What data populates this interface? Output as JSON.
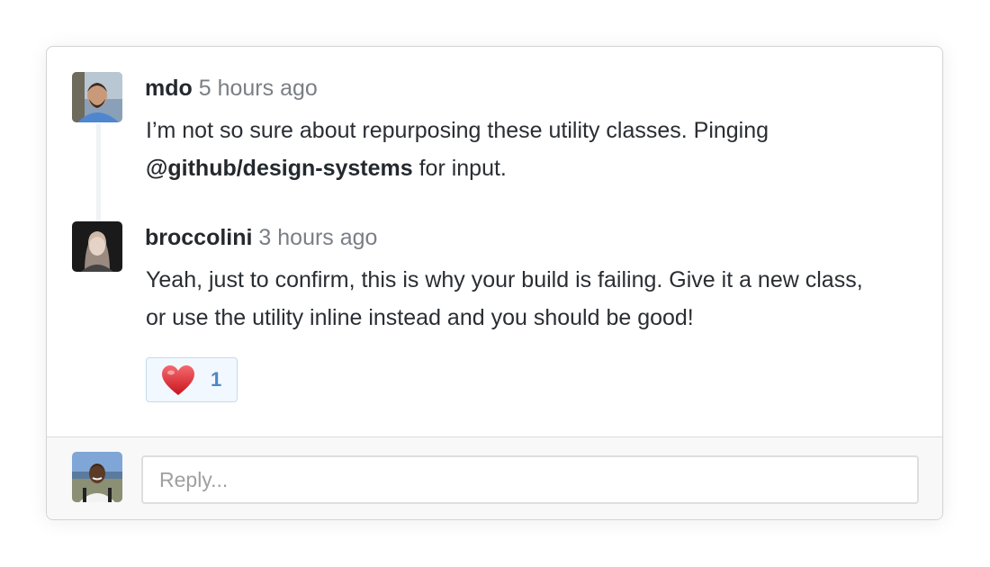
{
  "comments": [
    {
      "author": "mdo",
      "time": "5 hours ago",
      "body_before": "I’m not so sure about repurposing these utility classes. Pinging ",
      "mention": "@github/design-systems",
      "body_after": " for input."
    },
    {
      "author": "broccolini",
      "time": "3 hours ago",
      "body": "Yeah, just to confirm, this is why your build is failing. Give it a new class, or use the utility inline instead and you should be good!",
      "reaction": {
        "icon": "heart-icon",
        "count": "1"
      }
    }
  ],
  "reply": {
    "placeholder": "Reply..."
  },
  "colors": {
    "author": "#24292e",
    "timestamp": "#7a7f85",
    "reaction_bg": "#f1f8ff",
    "reaction_border": "#c4dbee",
    "reaction_count": "#4f86c4",
    "heart": "#e0262b"
  }
}
